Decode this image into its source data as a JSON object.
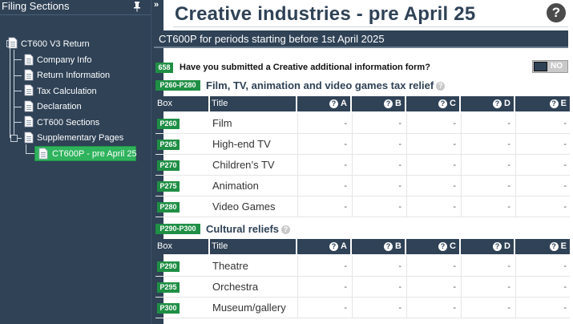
{
  "sidebar": {
    "title": "Filing Sections",
    "collapse_glyph": "»",
    "tree": {
      "root": "CT600 V3 Return",
      "items": [
        "Company Info",
        "Return Information",
        "Tax Calculation",
        "Declaration",
        "CT600 Sections",
        "Supplementary Pages"
      ],
      "selected": "CT600P - pre April 25"
    }
  },
  "main": {
    "title": "Creative industries - pre April 25",
    "help_glyph": "?",
    "banner": "CT600P for periods starting before 1st April 2025",
    "question": {
      "box": "658",
      "text": "Have you submitted a Creative additional information form?",
      "toggle_label": "NO",
      "value": "NO"
    },
    "column_headers": {
      "box": "Box",
      "title": "Title",
      "cols": [
        "A",
        "B",
        "C",
        "D",
        "E"
      ]
    },
    "sections": [
      {
        "range": "P260-P280",
        "title": "Film, TV, animation and video games tax relief",
        "rows": [
          {
            "code": "P260",
            "title": "Film",
            "values": [
              "-",
              "-",
              "-",
              "-",
              "-"
            ]
          },
          {
            "code": "P265",
            "title": "High-end TV",
            "values": [
              "-",
              "-",
              "-",
              "-",
              "-"
            ]
          },
          {
            "code": "P270",
            "title": "Children’s TV",
            "values": [
              "-",
              "-",
              "-",
              "-",
              "-"
            ]
          },
          {
            "code": "P275",
            "title": "Animation",
            "values": [
              "-",
              "-",
              "-",
              "-",
              "-"
            ]
          },
          {
            "code": "P280",
            "title": "Video Games",
            "values": [
              "-",
              "-",
              "-",
              "-",
              "-"
            ]
          }
        ]
      },
      {
        "range": "P290-P300",
        "title": "Cultural reliefs",
        "rows": [
          {
            "code": "P290",
            "title": "Theatre",
            "values": [
              "-",
              "-",
              "-",
              "-",
              "-"
            ]
          },
          {
            "code": "P295",
            "title": "Orchestra",
            "values": [
              "-",
              "-",
              "-",
              "-",
              "-"
            ]
          },
          {
            "code": "P300",
            "title": "Museum/gallery",
            "values": [
              "-",
              "-",
              "-",
              "-",
              "-"
            ]
          }
        ]
      }
    ]
  },
  "colors": {
    "navy": "#2f4256",
    "green": "#1f8f45",
    "selected": "#2fb35d"
  },
  "icons": {
    "pin": "pin-icon",
    "collapse": "double-chevron-right-icon",
    "help": "help-circle-icon",
    "document": "document-icon"
  }
}
